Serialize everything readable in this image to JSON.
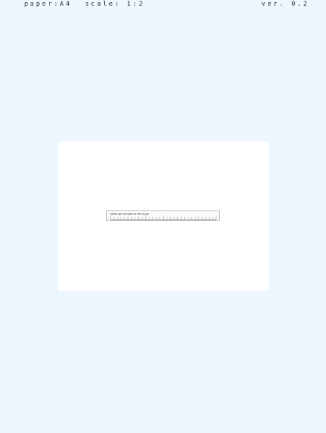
{
  "header": {
    "paper": "paper:A4",
    "scale": "scale: 1:2",
    "version": "ver. 0.2"
  },
  "ruler": {
    "caption": "THESE ARE NOT SEEN IN THE RULER",
    "tick_count": 30
  }
}
